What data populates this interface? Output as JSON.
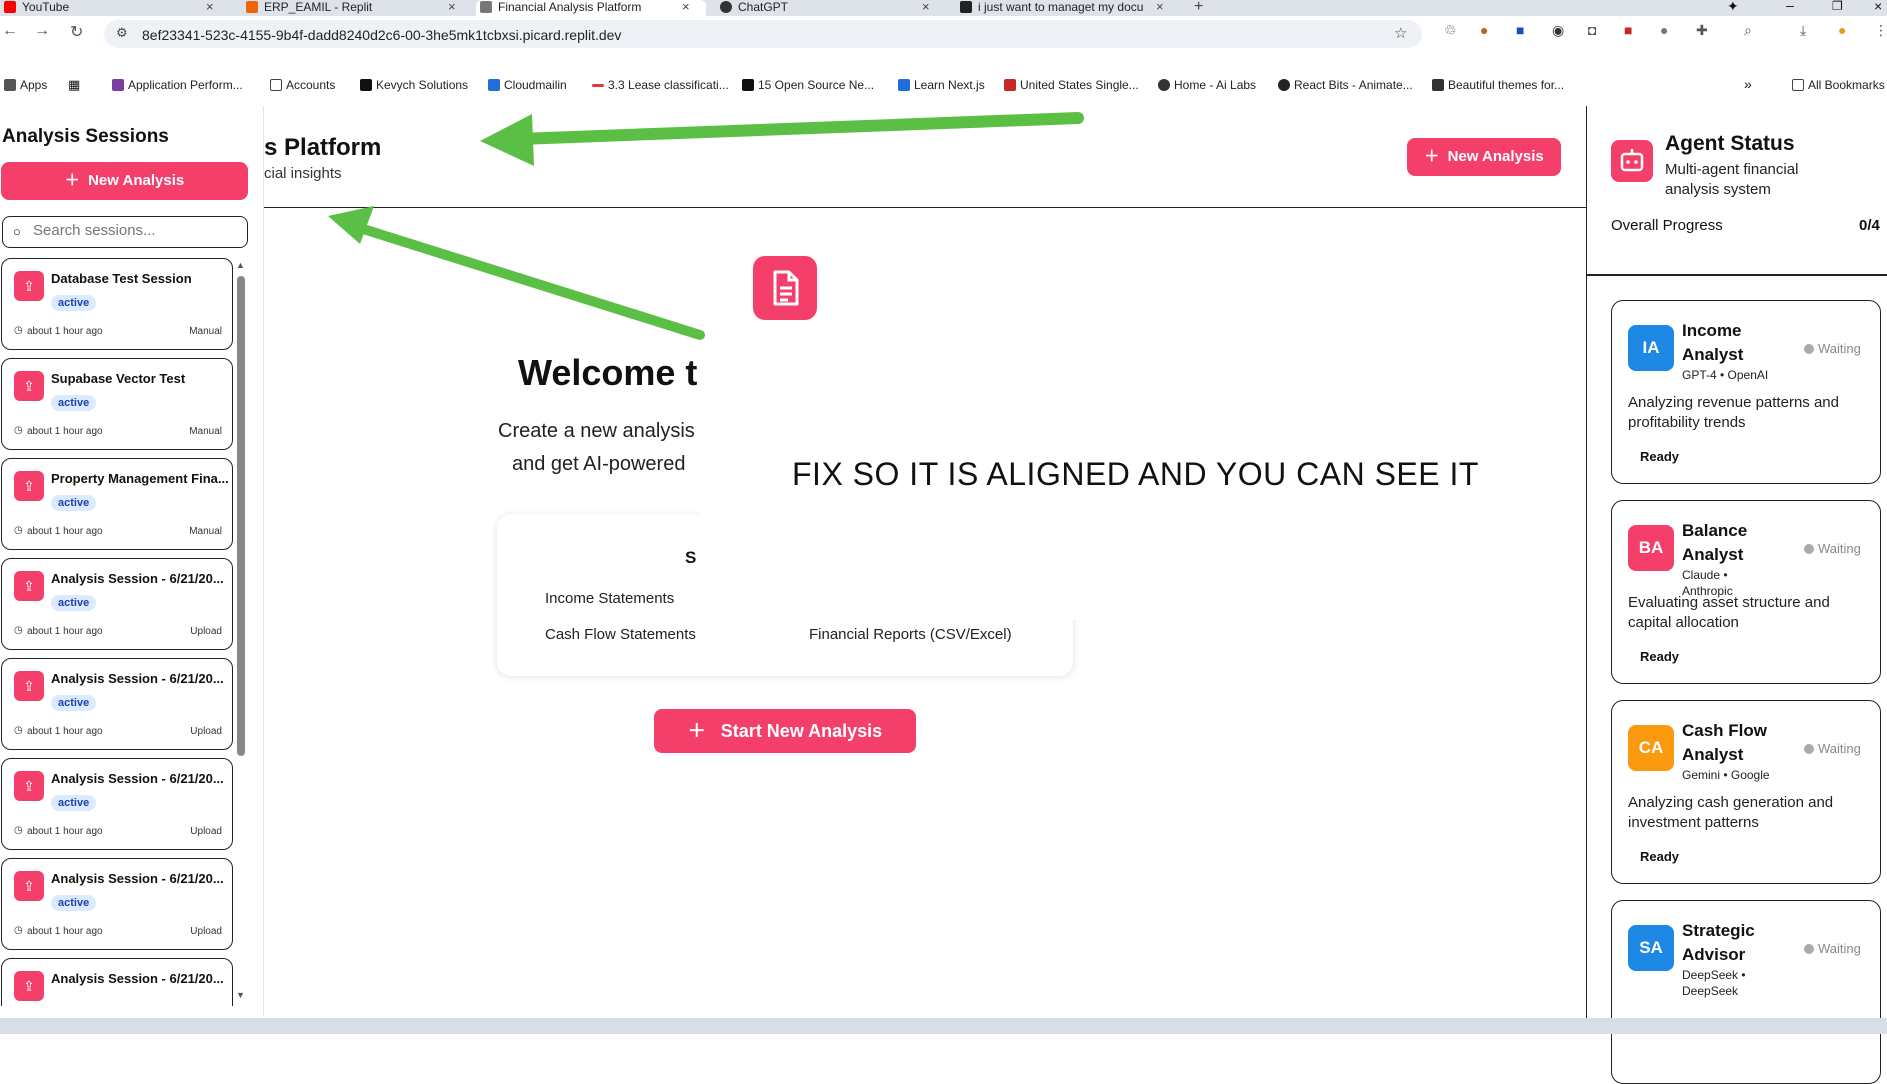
{
  "browser": {
    "tabs": [
      {
        "label": "YouTube",
        "color": "#ff0000"
      },
      {
        "label": "ERP_EAMIL - Replit",
        "color": "#f26207"
      },
      {
        "label": "Financial Analysis Platform",
        "color": "#777777"
      },
      {
        "label": "ChatGPT",
        "color": "#333333"
      },
      {
        "label": "i just want to managet my docu",
        "color": "#222222"
      }
    ],
    "url": "8ef23341-523c-4155-9b4f-dadd8240d2c6-00-3he5mk1tcbxsi.picard.replit.dev",
    "bookmarks": [
      "Apps",
      "Application Perform...",
      "Accounts",
      "Kevych Solutions",
      "Cloudmailin",
      "3.3 Lease classificati...",
      "15 Open Source Ne...",
      "Learn Next.js",
      "United States Single...",
      "Home - Ai Labs",
      "React Bits - Animate...",
      "Beautiful themes for...",
      "All Bookmarks"
    ]
  },
  "sidebar": {
    "title": "Analysis Sessions",
    "new_button": "New Analysis",
    "search_placeholder": "Search sessions...",
    "sessions": [
      {
        "title": "Database Test Session",
        "status": "active",
        "time": "about 1 hour ago",
        "source": "Manual"
      },
      {
        "title": "Supabase Vector Test",
        "status": "active",
        "time": "about 1 hour ago",
        "source": "Manual"
      },
      {
        "title": "Property Management Fina...",
        "status": "active",
        "time": "about 1 hour ago",
        "source": "Manual"
      },
      {
        "title": "Analysis Session - 6/21/20...",
        "status": "active",
        "time": "about 1 hour ago",
        "source": "Upload"
      },
      {
        "title": "Analysis Session - 6/21/20...",
        "status": "active",
        "time": "about 1 hour ago",
        "source": "Upload"
      },
      {
        "title": "Analysis Session - 6/21/20...",
        "status": "active",
        "time": "about 1 hour ago",
        "source": "Upload"
      },
      {
        "title": "Analysis Session - 6/21/20...",
        "status": "active",
        "time": "about 1 hour ago",
        "source": "Upload"
      },
      {
        "title": "Analysis Session - 6/21/20...",
        "status": "",
        "time": "",
        "source": ""
      }
    ]
  },
  "header": {
    "title_fragment": "s Platform",
    "subtitle_fragment": "cial insights",
    "new_button": "New Analysis"
  },
  "main": {
    "welcome_fragment": "Welcome t",
    "desc_line1": "Create a new analysis",
    "desc_line2": "and get AI-powered",
    "formats_heading_fragment": "S",
    "formats": [
      "Income Statements",
      "Cash Flow Statements",
      "Financial Reports (CSV/Excel)"
    ],
    "start_button": "Start New Analysis"
  },
  "annotation": {
    "note": "FIX SO IT IS ALIGNED AND YOU CAN SEE IT",
    "arrow_color": "#5bbf45"
  },
  "agents_panel": {
    "title": "Agent Status",
    "subtitle": "Multi-agent financial analysis system",
    "progress_label": "Overall Progress",
    "progress_value": "0/4",
    "agents": [
      {
        "initials": "IA",
        "name": "Income Analyst",
        "model": "GPT-4 • OpenAI",
        "status": "Waiting",
        "description": "Analyzing revenue patterns and profitability trends",
        "readiness": "Ready",
        "color": "#1e88e5"
      },
      {
        "initials": "BA",
        "name": "Balance Analyst",
        "model": "Claude • Anthropic",
        "status": "Waiting",
        "description": "Evaluating asset structure and capital allocation",
        "readiness": "Ready",
        "color": "#f43f6b"
      },
      {
        "initials": "CA",
        "name": "Cash Flow Analyst",
        "model": "Gemini • Google",
        "status": "Waiting",
        "description": "Analyzing cash generation and investment patterns",
        "readiness": "Ready",
        "color": "#fb9a0e"
      },
      {
        "initials": "SA",
        "name": "Strategic Advisor",
        "model": "DeepSeek • DeepSeek",
        "status": "Waiting",
        "description": "",
        "readiness": "",
        "color": "#1e88e5"
      }
    ]
  },
  "colors": {
    "accent": "#f43f6b",
    "badge_bg": "#dbeafe",
    "badge_text": "#1e40af"
  }
}
